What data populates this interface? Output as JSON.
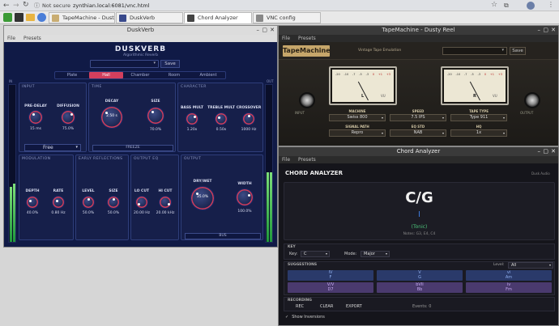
{
  "browser": {
    "address": "Not secure",
    "url": "zynthian.local:6081/vnc.html",
    "tabs": [
      {
        "label": "TapeMachine - Dusty Reel"
      },
      {
        "label": "DuskVerb"
      },
      {
        "label": "Chord Analyzer"
      },
      {
        "label": "VNC config"
      }
    ]
  },
  "duskverb": {
    "title": "DuskVerb",
    "menu": [
      "File",
      "Presets"
    ],
    "brand": "DUSKVERB",
    "subtitle": "Algorithmic Reverb",
    "save": "Save",
    "modes": [
      "Plate",
      "Hall",
      "Chamber",
      "Room",
      "Ambient"
    ],
    "active_mode": "Hall",
    "sections": {
      "input": "INPUT",
      "time": "TIME",
      "character": "CHARACTER",
      "modulation": "MODULATION",
      "early": "EARLY REFLECTIONS",
      "outputeq": "OUTPUT EQ",
      "output": "OUTPUT"
    },
    "knobs": {
      "predelay": {
        "label": "PRE-DELAY",
        "value": "15 ms"
      },
      "diffusion": {
        "label": "DIFFUSION",
        "value": "75.0%"
      },
      "decay": {
        "label": "DECAY",
        "value": "2.50 s"
      },
      "size": {
        "label": "SIZE",
        "value": "70.0%"
      },
      "bassmult": {
        "label": "BASS MULT",
        "value": "1.20x"
      },
      "treblemult": {
        "label": "TREBLE MULT",
        "value": "0.50x"
      },
      "crossover": {
        "label": "CROSSOVER",
        "value": "1000 Hz"
      },
      "depth": {
        "label": "DEPTH",
        "value": "40.0%"
      },
      "rate": {
        "label": "RATE",
        "value": "0.80 Hz"
      },
      "level": {
        "label": "LEVEL",
        "value": "50.0%"
      },
      "ersize": {
        "label": "SIZE",
        "value": "50.0%"
      },
      "locut": {
        "label": "LO CUT",
        "value": "20.00 Hz"
      },
      "hicut": {
        "label": "HI CUT",
        "value": "20.00 kHz"
      },
      "drywet": {
        "label": "DRY/WET",
        "value": "35.0%"
      },
      "width": {
        "label": "WIDTH",
        "value": "100.0%"
      }
    },
    "free": "Free",
    "freeze": "FREEZE",
    "bus": "BUS",
    "in_label": "IN",
    "out_label": "OUT"
  },
  "tape": {
    "title": "TapeMachine - Dusty Reel",
    "menu": [
      "File",
      "Presets"
    ],
    "brand": "TapeMachine",
    "subtitle": "Vintage Tape Emulation",
    "save": "Save",
    "meter_l": "L",
    "meter_r": "R",
    "vu": "VU",
    "scale": [
      "-20",
      "-10",
      "-7",
      "-5",
      "-3",
      "0",
      "+1",
      "+3"
    ],
    "input": "INPUT",
    "output": "OUTPUT",
    "controls": [
      {
        "label": "MACHINE",
        "value": "Swiss 800"
      },
      {
        "label": "SPEED",
        "value": "7.5 IPS"
      },
      {
        "label": "TAPE TYPE",
        "value": "Type 911"
      },
      {
        "label": "SIGNAL PATH",
        "value": "Repro"
      },
      {
        "label": "EQ STD",
        "value": "NAB"
      },
      {
        "label": "HQ",
        "value": "1x"
      }
    ]
  },
  "chord": {
    "title": "Chord Analyzer",
    "menu": [
      "File",
      "Presets"
    ],
    "heading": "CHORD ANALYZER",
    "vendor": "Dusk Audio",
    "chord": "C/G",
    "degree": "I",
    "function": "(Tonic)",
    "notes": "Notes: G3, E4, C4",
    "key_section": "KEY",
    "key_label": "Key:",
    "key_value": "C",
    "mode_label": "Mode:",
    "mode_value": "Major",
    "suggestions": "SUGGESTIONS",
    "level_label": "Level:",
    "level_value": "All",
    "grid": [
      [
        {
          "roman": "IV",
          "name": "F"
        },
        {
          "roman": "V",
          "name": "G"
        },
        {
          "roman": "vi",
          "name": "Am"
        }
      ],
      [
        {
          "roman": "V/V",
          "name": "D7"
        },
        {
          "roman": "bVII",
          "name": "Bb"
        },
        {
          "roman": "iv",
          "name": "Fm"
        }
      ]
    ],
    "recording": "RECORDING",
    "rec": "REC",
    "clear": "CLEAR",
    "export": "EXPORT",
    "events": "Events: 0",
    "show_inversions": "Show Inversions"
  }
}
